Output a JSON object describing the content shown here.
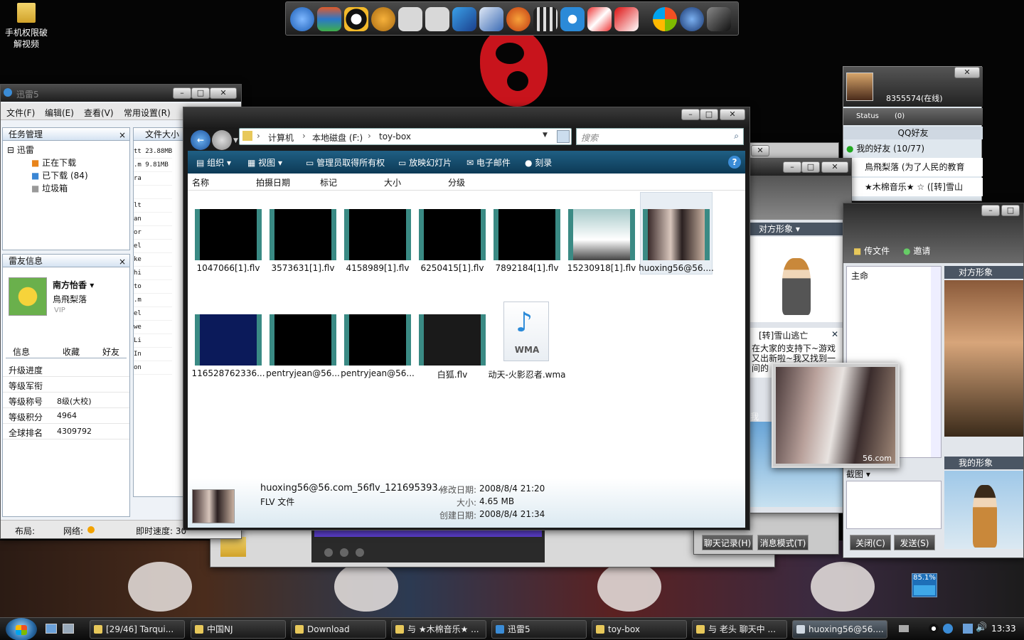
{
  "desktop": {
    "icon_label": "手机权限破解视频",
    "battery_indicator": "85.1%"
  },
  "quick_launch": {
    "icons": [
      "maxthon-icon",
      "books-icon",
      "qq-penguin-icon",
      "media-icon",
      "unknown-icon",
      "unknown-icon",
      "tools-icon",
      "shield-icon",
      "player-icon",
      "clapper-icon",
      "record-icon",
      "gift-icon",
      "knife-icon",
      "windows-icon",
      "search-icon",
      "dark-icon"
    ]
  },
  "explorer": {
    "breadcrumb": [
      "计算机",
      "本地磁盘 (F:)",
      "toy-box"
    ],
    "search_placeholder": "搜索",
    "commands": [
      "组织",
      "视图",
      "管理员取得所有权",
      "放映幻灯片",
      "电子邮件",
      "刻录"
    ],
    "columns": [
      "名称",
      "拍摄日期",
      "标记",
      "大小",
      "分级"
    ],
    "files_row1": [
      "1047066[1].flv",
      "3573631[1].flv",
      "4158989[1].flv",
      "6250415[1].flv",
      "7892184[1].flv",
      "15230918[1].flv",
      "huoxing56@56...."
    ],
    "files_row2": [
      "116528762336...",
      "pentryjean@56...",
      "pentryjean@56...",
      "白狐.flv",
      "动天-火影忍者.wma"
    ],
    "wma_label": "WMA",
    "details": {
      "name": "huoxing56@56.com_56flv_121695393...",
      "type": "FLV 文件",
      "modified_label": "修改日期:",
      "modified": "2008/8/4 21:20",
      "size_label": "大小:",
      "size": "4.65 MB",
      "created_label": "创建日期:",
      "created": "2008/8/4 21:34"
    }
  },
  "xunlei": {
    "title": "迅雷5",
    "menu": [
      "文件(F)",
      "编辑(E)",
      "查看(V)",
      "常用设置(R)"
    ],
    "task_header": "任务管理",
    "tree_root": "迅雷",
    "tree_items": [
      "正在下载",
      "已下载 (84)",
      "垃圾箱"
    ],
    "col_header": "文件大小",
    "sizes": [
      "tt 23.88MB",
      ".m 9.81MB",
      "ra",
      "",
      "lt",
      "an",
      "or",
      "el",
      "ke",
      "hi",
      "to",
      ".m",
      "el",
      "we",
      "Li",
      "In",
      "on"
    ],
    "friend_header": "雷友信息",
    "user_name": "南方怡香",
    "user_sub": "鳥飛梨落",
    "vip": "VIP",
    "tabs": [
      "信息",
      "收藏",
      "好友"
    ],
    "stats": [
      {
        "label": "升级进度",
        "value": ""
      },
      {
        "label": "等级军衔",
        "value": ""
      },
      {
        "label": "等级称号",
        "value": "8级(大校)"
      },
      {
        "label": "等级积分",
        "value": "4964"
      },
      {
        "label": "全球排名",
        "value": "4309792"
      }
    ],
    "status_layout": "布局:",
    "status_network": "网络:",
    "status_speed": "即时速度: 30"
  },
  "qq": {
    "number": "8355574(在线)",
    "status": "Status",
    "mail_count": "(0)",
    "group_title": "QQ好友",
    "my_friends": "我的好友 (10/77)",
    "friends": [
      "鳥飛梨落 (为了人民的教育",
      "★木棉音乐★ ☆ ([转]雪山"
    ]
  },
  "chat": {
    "peer_image_label": "对方形象",
    "send_file": "传文件",
    "invite": "邀请",
    "right_peer_label": "对方形象",
    "my_image_label": "我的形象",
    "news_title": "[转]雪山逃亡",
    "news_text": "在大家的支持下~游戏又出新啦~我又找到一间的",
    "snapshot": "截图",
    "history": "聊天记录(H)",
    "mode": "消息模式(T)",
    "close": "关闭(C)",
    "send": "发送(S)",
    "partial_labels": [
      "主命",
      "我"
    ]
  },
  "video": {
    "watermark": "56.com"
  },
  "taskbar": {
    "buttons": [
      "[29/46] Tarqui...",
      "中国NJ",
      "Download",
      "与 ★木棉音乐★ ...",
      "迅雷5",
      "toy-box",
      "与 老头 聊天中 ...",
      "huoxing56@56...."
    ],
    "clock": "13:33"
  }
}
